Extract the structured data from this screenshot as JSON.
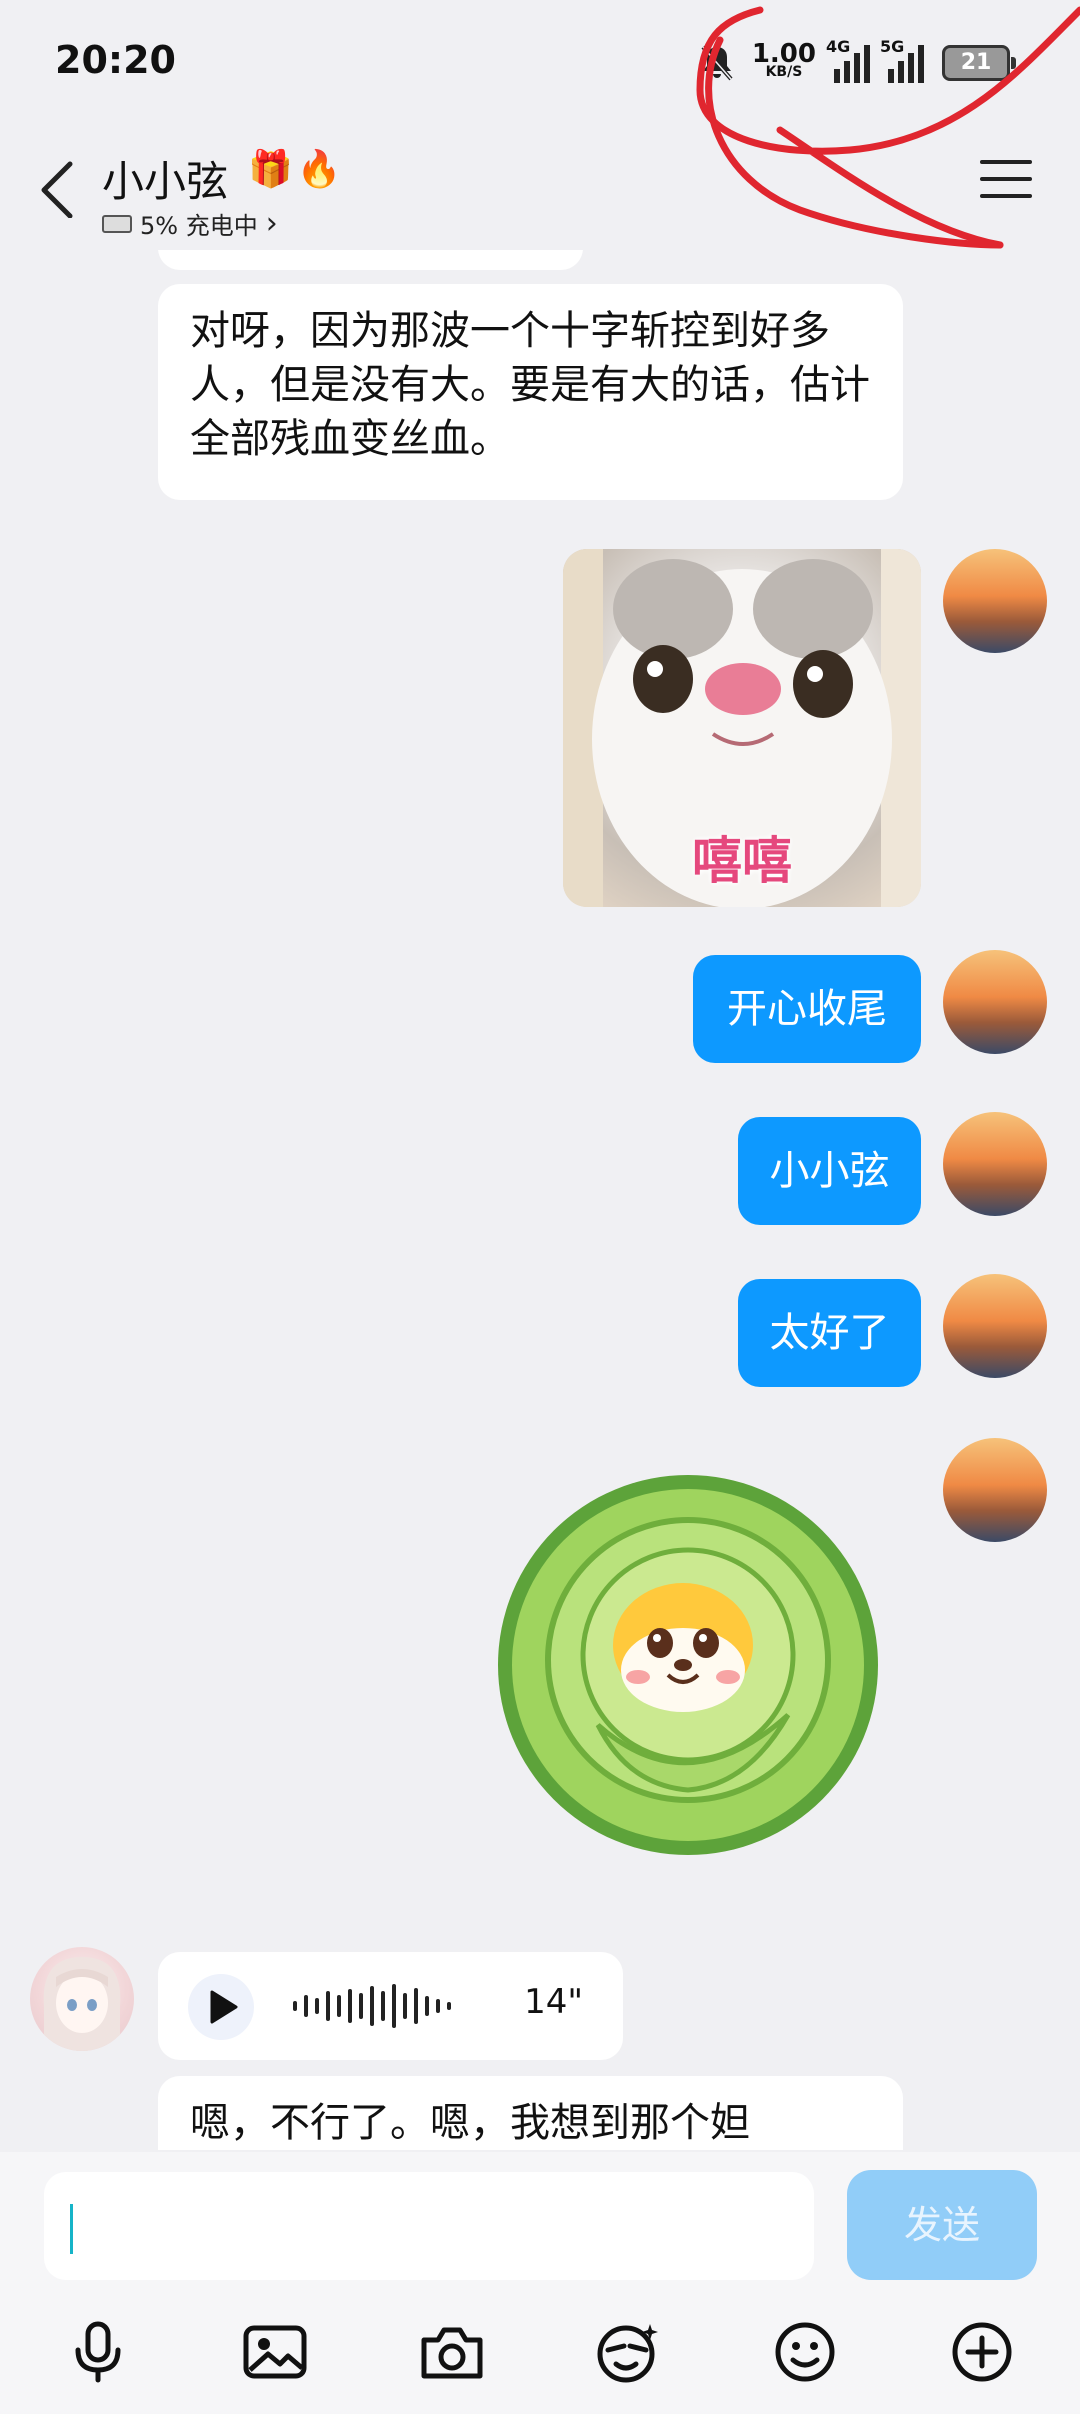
{
  "status": {
    "time": "20:20",
    "speed_value": "1.00",
    "speed_unit": "KB/S",
    "net1": "4G",
    "net2": "5G",
    "battery": "21"
  },
  "header": {
    "name": "小小弦",
    "badges": "🎁🔥",
    "sub": "5% 充电中",
    "sub_chevron": "›"
  },
  "messages": {
    "incoming_top": "对呀，因为那波一个十字斩控到好多人，但是没有大。要是有大的话，估计全部残血变丝血。",
    "sticker_caption": "嘻嘻",
    "out1": "开心收尾",
    "out2": "小小弦",
    "out3": "太好了",
    "voice_length": "14\"",
    "incoming_bottom": "嗯，不行了。嗯，我想到那个妲"
  },
  "input": {
    "send_label": "发送"
  },
  "icons": {
    "toolbar": [
      "microphone-icon",
      "image-icon",
      "camera-icon",
      "sticker-face-icon",
      "emoji-icon",
      "plus-icon"
    ]
  },
  "colors": {
    "accent": "#0d99ff",
    "send_disabled": "#91cdf8",
    "annotation": "#e0262f"
  }
}
